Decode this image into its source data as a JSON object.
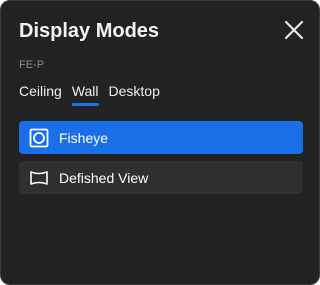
{
  "dialog": {
    "title": "Display Modes",
    "device": "FE-P"
  },
  "tabs": [
    {
      "label": "Ceiling",
      "active": false
    },
    {
      "label": "Wall",
      "active": true
    },
    {
      "label": "Desktop",
      "active": false
    }
  ],
  "modes": [
    {
      "label": "Fisheye",
      "icon": "fisheye-icon",
      "selected": true
    },
    {
      "label": "Defished View",
      "icon": "defished-view-icon",
      "selected": false
    }
  ],
  "colors": {
    "background": "#222223",
    "accent": "#1a6ee6",
    "item_background": "#2f2f30"
  }
}
